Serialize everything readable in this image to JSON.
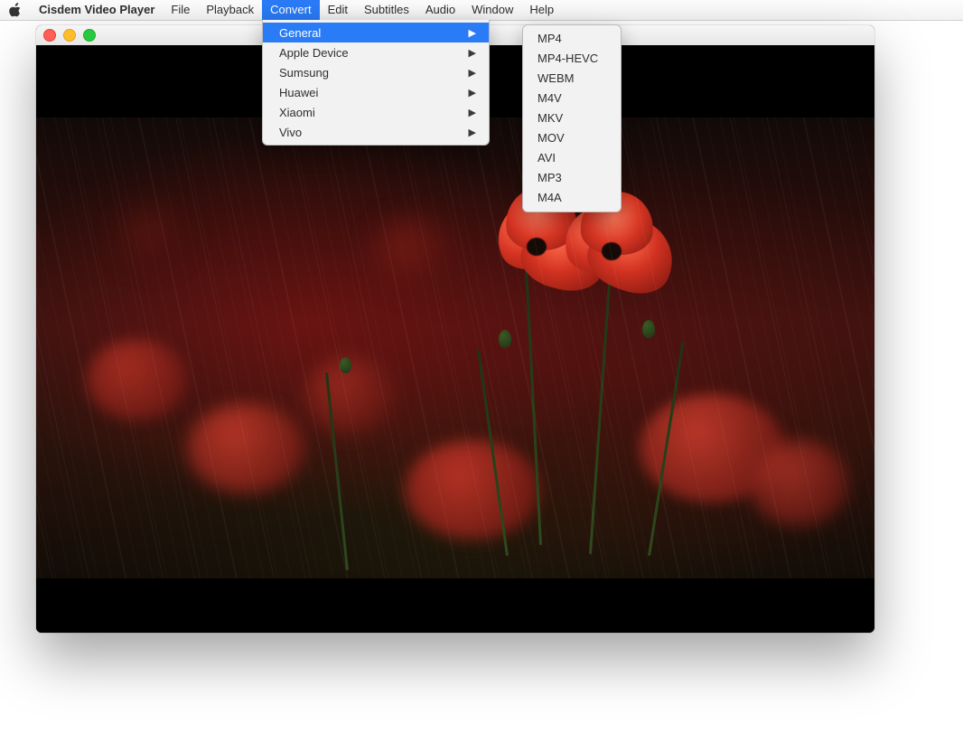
{
  "menubar": {
    "appname": "Cisdem Video Player",
    "items": [
      "File",
      "Playback",
      "Convert",
      "Edit",
      "Subtitles",
      "Audio",
      "Window",
      "Help"
    ],
    "active_index": 2
  },
  "convert_menu": {
    "items": [
      "General",
      "Apple Device",
      "Sumsung",
      "Huawei",
      "Xiaomi",
      "Vivo"
    ],
    "selected_index": 0
  },
  "general_submenu": {
    "items": [
      "MP4",
      "MP4-HEVC",
      "WEBM",
      "M4V",
      "MKV",
      "MOV",
      "AVI",
      "MP3",
      "M4A"
    ]
  }
}
